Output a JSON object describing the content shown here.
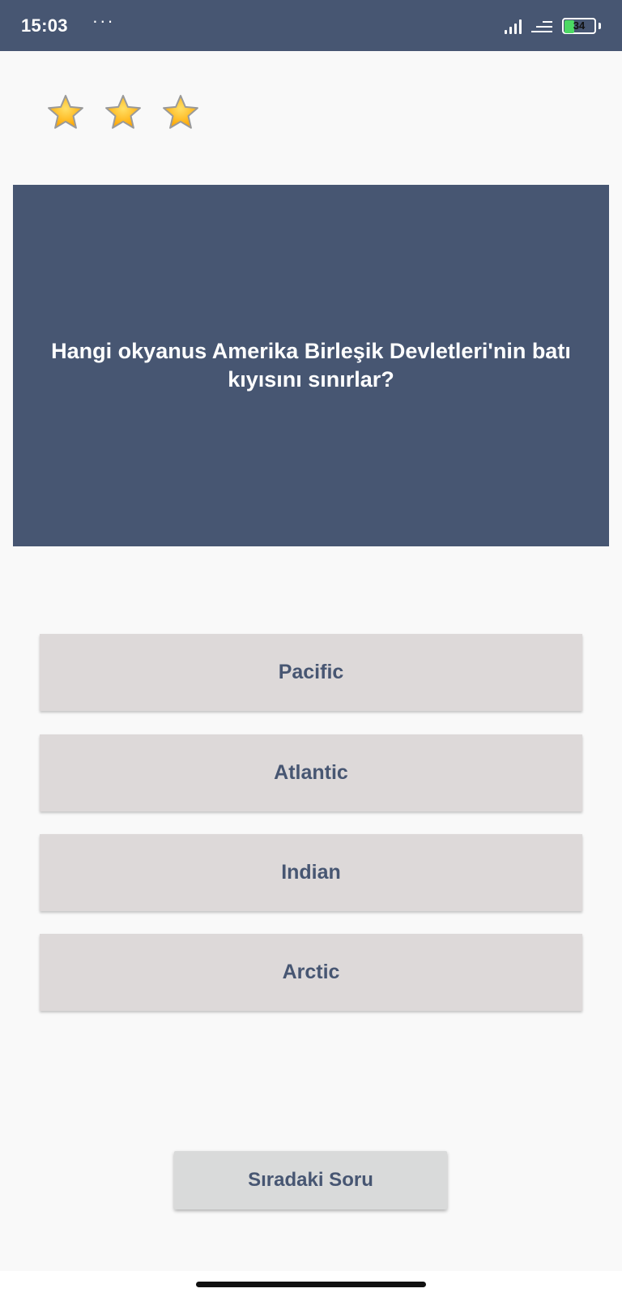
{
  "status_bar": {
    "time": "15:03",
    "dots": "···",
    "battery_level": "34",
    "signal_icon": "signal-bars-icon",
    "wifi_icon": "wifi-icon",
    "battery_icon": "battery-icon"
  },
  "rating": {
    "stars_filled": 3,
    "stars_total": 3,
    "star_icon": "star-icon"
  },
  "question": {
    "text": "Hangi okyanus Amerika Birleşik Devletleri'nin batı kıyısını sınırlar?"
  },
  "answers": [
    {
      "label": "Pacific"
    },
    {
      "label": "Atlantic"
    },
    {
      "label": "Indian"
    },
    {
      "label": "Arctic"
    }
  ],
  "next_button": {
    "label": "Sıradaki Soru"
  },
  "colors": {
    "primary": "#475672",
    "answer_bg": "#ddd9d9",
    "page_bg": "#f9f9f9",
    "star_fill": "#ffa500"
  }
}
